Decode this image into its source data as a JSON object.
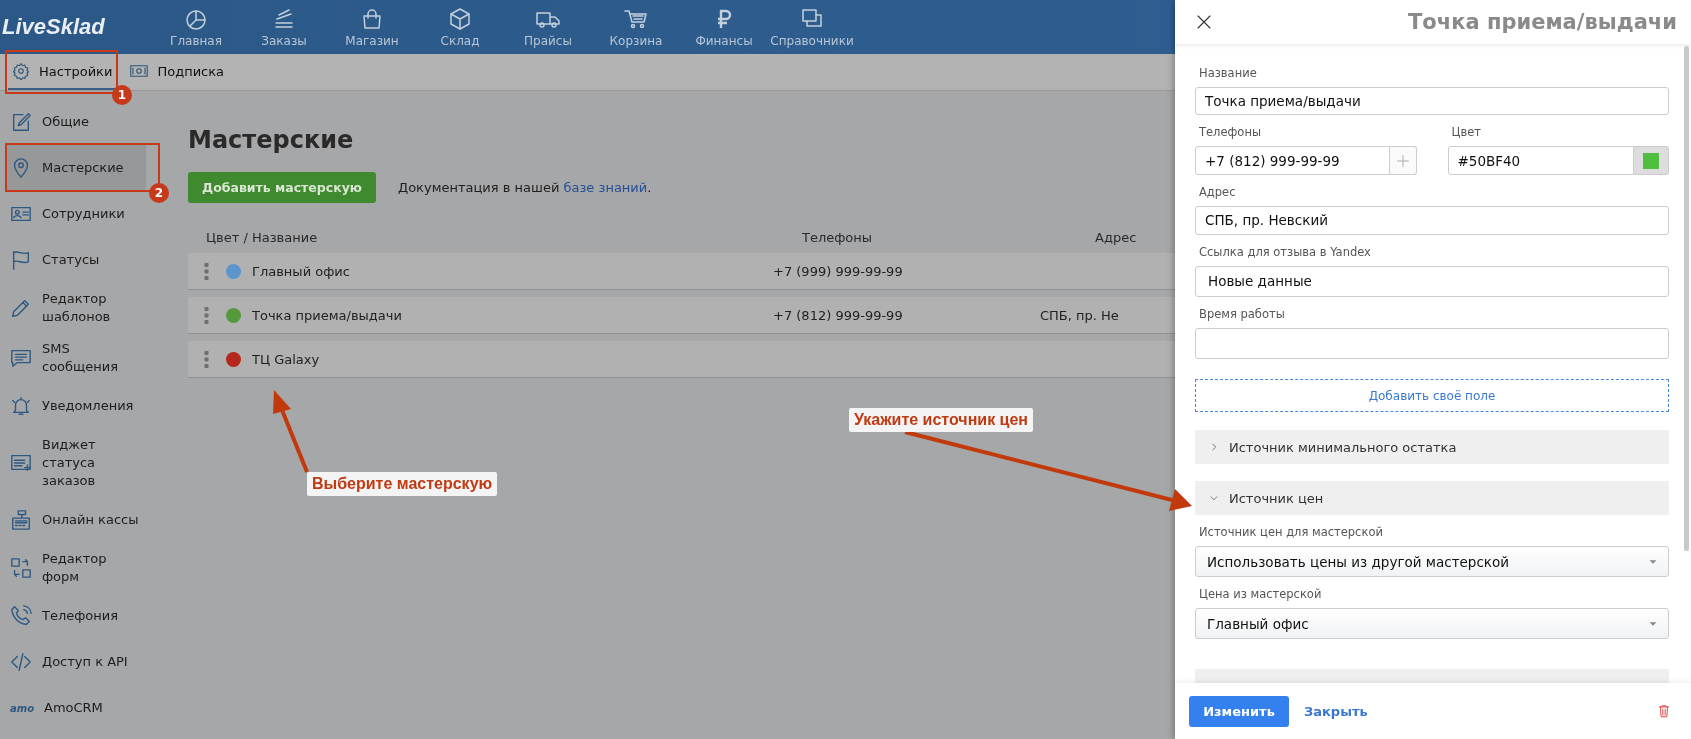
{
  "logo": "LiveSklad",
  "nav": [
    {
      "label": "Главная"
    },
    {
      "label": "Заказы"
    },
    {
      "label": "Магазин"
    },
    {
      "label": "Склад"
    },
    {
      "label": "Прайсы"
    },
    {
      "label": "Корзина"
    },
    {
      "label": "Финансы"
    },
    {
      "label": "Справочники"
    }
  ],
  "subtabs": [
    {
      "label": "Настройки",
      "selected": true
    },
    {
      "label": "Подписка",
      "selected": false
    }
  ],
  "sidebar": {
    "items": [
      {
        "label": "Общие",
        "selected": false
      },
      {
        "label": "Мастерские",
        "selected": true
      },
      {
        "label": "Сотрудники",
        "selected": false
      },
      {
        "label": "Статусы",
        "selected": false
      },
      {
        "label": "Редактор шаблонов",
        "selected": false
      },
      {
        "label": "SMS сообщения",
        "selected": false
      },
      {
        "label": "Уведомления",
        "selected": false
      },
      {
        "label": "Виджет статуса заказов",
        "selected": false
      },
      {
        "label": "Онлайн кассы",
        "selected": false
      },
      {
        "label": "Редактор форм",
        "selected": false
      },
      {
        "label": "Телефония",
        "selected": false
      },
      {
        "label": "Доступ к API",
        "selected": false
      },
      {
        "label": "AmoCRM",
        "selected": false,
        "logo_text": "amo"
      }
    ]
  },
  "page": {
    "title": "Мастерские",
    "add_button": "Добавить мастерскую",
    "doc_before": "Документация в нашей ",
    "doc_link": "базе знаний",
    "doc_after": "."
  },
  "table": {
    "columns": [
      "Цвет / Название",
      "Телефоны",
      "Адрес"
    ],
    "rows": [
      {
        "color": "#5b95c9",
        "name": "Главный офис",
        "phone": "+7 (999) 999-99-99"
      },
      {
        "color": "#56993d",
        "name": "Точка приема/выдачи",
        "phone": "+7 (812) 999-99-99",
        "address": "СПБ, пр. Не"
      },
      {
        "color": "#b5271d",
        "name": "ТЦ Galaxy"
      }
    ]
  },
  "panel": {
    "title": "Точка приема/выдачи",
    "name": {
      "label": "Название",
      "value": "Точка приема/выдачи"
    },
    "phones": {
      "label": "Телефоны",
      "value": "+7 (812) 999-99-99"
    },
    "color": {
      "label": "Цвет",
      "value": "#50BF40"
    },
    "address": {
      "label": "Адрес",
      "value": "СПБ, пр. Невский"
    },
    "review_link": {
      "label": "Ссылка для отзыва в Yandex",
      "value": "Новые данные"
    },
    "hours": {
      "label": "Время работы"
    },
    "add_field": "Добавить своё поле",
    "sections": [
      {
        "title": "Источник минимального остатка",
        "expanded": false
      },
      {
        "title": "Источник цен",
        "expanded": true
      }
    ],
    "price_source": {
      "label": "Источник цен для мастерской",
      "value": "Использовать цены из другой мастерской"
    },
    "price_from": {
      "label": "Цена из мастерской",
      "value": "Главный офис"
    },
    "save_button": "Изменить",
    "close_link": "Закрыть"
  },
  "annotations": {
    "markers": [
      {
        "number": "1"
      },
      {
        "number": "2"
      }
    ],
    "callouts": [
      {
        "text": "Выберите мастерскую"
      },
      {
        "text": "Укажите источник цен"
      }
    ]
  }
}
